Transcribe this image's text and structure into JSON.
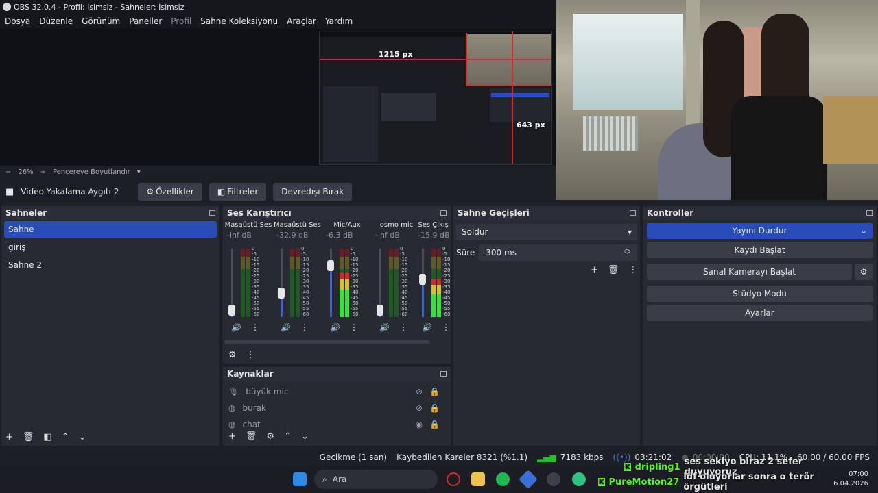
{
  "window": {
    "title": "OBS 32.0.4 - Profil: İsimsiz - Sahneler: İsimsiz"
  },
  "menu": [
    "Dosya",
    "Düzenle",
    "Görünüm",
    "Paneller",
    "Profil",
    "Sahne Koleksiyonu",
    "Araçlar",
    "Yardım"
  ],
  "preview": {
    "zoom": "26%",
    "fit_label": "Pencereye Boyutlandır",
    "label_width": "1215 px",
    "label_height": "643 px"
  },
  "source_bar": {
    "source_name": "Video Yakalama Aygıtı 2",
    "properties": "Özellikler",
    "filters": "Filtreler",
    "deactivate": "Devredışı Bırak"
  },
  "scenes": {
    "title": "Sahneler",
    "items": [
      "Sahne",
      "giriş",
      "Sahne 2"
    ]
  },
  "mixer": {
    "title": "Ses Karıştırıcı",
    "channels": [
      {
        "name": "Masaüstü Ses",
        "db": "-inf dB",
        "level": 0.0,
        "fader": 0.1
      },
      {
        "name": "Masaüstü Ses 2",
        "db": "-32.9 dB",
        "level": 0.0,
        "fader": 0.35
      },
      {
        "name": "Mic/Aux",
        "db": "-6.3 dB",
        "level": 0.65,
        "fader": 0.75
      },
      {
        "name": "osmo mic",
        "db": "-inf dB",
        "level": 0.0,
        "fader": 0.1
      },
      {
        "name": "Ses Çıkış Yal",
        "db": "-15.9 dB",
        "level": 0.55,
        "fader": 0.55
      }
    ],
    "ticks": [
      "0",
      "-5",
      "-10",
      "-15",
      "-20",
      "-25",
      "-30",
      "-35",
      "-40",
      "-45",
      "-50",
      "-55",
      "-60"
    ]
  },
  "transitions": {
    "title": "Sahne Geçişleri",
    "selected": "Soldur",
    "duration_label": "Süre",
    "duration_value": "300 ms"
  },
  "controls": {
    "title": "Kontroller",
    "stop_stream": "Yayını Durdur",
    "start_record": "Kaydı Başlat",
    "start_virtualcam": "Sanal Kamerayı Başlat",
    "studio_mode": "Stüdyo Modu",
    "settings": "Ayarlar"
  },
  "sources": {
    "title": "Kaynaklar",
    "items": [
      "büyük mic",
      "burak",
      "chat"
    ]
  },
  "status": {
    "delay": "Gecikme (1 san)",
    "dropped": "Kaybedilen Kareler 8321 (%1.1)",
    "kbps": "7183 kbps",
    "stream_time": "03:21:02",
    "record_time": "00:00:00",
    "cpu": "CPU: 11.1%",
    "fps": "60.00 / 60.00 FPS"
  },
  "taskbar": {
    "search_placeholder": "Ara",
    "time": "07:00",
    "date": "6.04.2026"
  },
  "chat": [
    {
      "user": "dripling1",
      "message": "ses sekiyo biraz 2 sefer duyuyoruz",
      "color": "#53fc18"
    },
    {
      "user": "PureMotion27",
      "message": "ldf oluyorlar sonra o terör örgütleri",
      "color": "#53fc18"
    }
  ],
  "colors": {
    "accent": "#284cb8",
    "red": "#e0252b",
    "meter_green": "#22c12a",
    "meter_yellow": "#c9b21c",
    "meter_red": "#c62020"
  }
}
